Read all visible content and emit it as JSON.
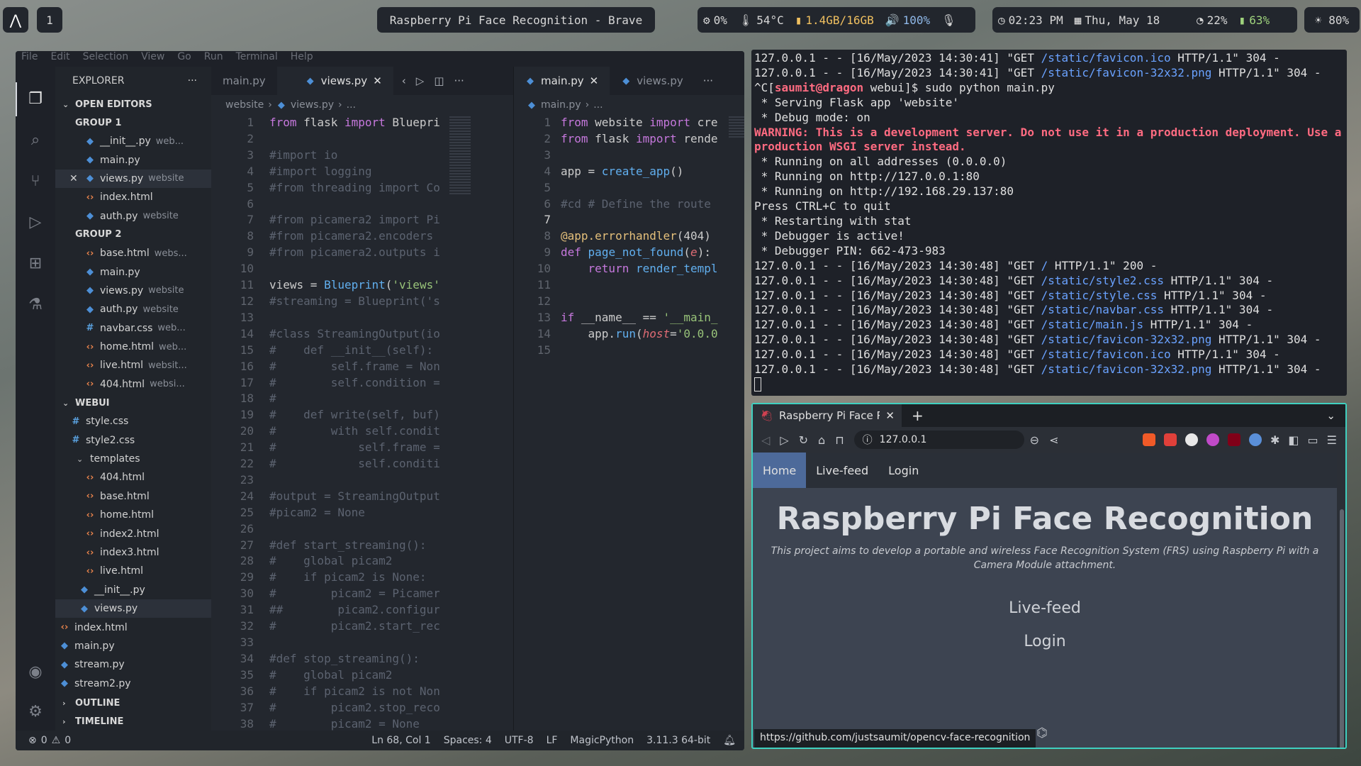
{
  "topbar": {
    "workspace": "1",
    "window_title": "Raspberry Pi Face Recognition - Brave",
    "cpu": "0%",
    "temp": "54°C",
    "memory": "1.4GB/16GB",
    "volume": "100%",
    "time": "02:23 PM",
    "date": "Thu, May 18",
    "wifi": "22%",
    "battery": "63%",
    "brightness": "80%"
  },
  "vscode": {
    "menu": [
      "File",
      "Edit",
      "Selection",
      "View",
      "Go",
      "Run",
      "Terminal",
      "Help"
    ],
    "explorer_title": "EXPLORER",
    "open_editors": "OPEN EDITORS",
    "group1": "GROUP 1",
    "group2": "GROUP 2",
    "group1_items": [
      {
        "name": "__init__.py",
        "desc": "web...",
        "type": "py"
      },
      {
        "name": "main.py",
        "desc": "",
        "type": "py"
      },
      {
        "name": "views.py",
        "desc": "website",
        "type": "py"
      },
      {
        "name": "index.html",
        "desc": "",
        "type": "html"
      },
      {
        "name": "auth.py",
        "desc": "website",
        "type": "py"
      }
    ],
    "group2_items": [
      {
        "name": "base.html",
        "desc": "webs...",
        "type": "html"
      },
      {
        "name": "main.py",
        "desc": "",
        "type": "py"
      },
      {
        "name": "views.py",
        "desc": "website",
        "type": "py"
      },
      {
        "name": "auth.py",
        "desc": "website",
        "type": "py"
      },
      {
        "name": "navbar.css",
        "desc": "web...",
        "type": "css"
      },
      {
        "name": "home.html",
        "desc": "web...",
        "type": "html"
      },
      {
        "name": "live.html",
        "desc": "websit...",
        "type": "html"
      },
      {
        "name": "404.html",
        "desc": "websi...",
        "type": "html"
      }
    ],
    "webui_section": "WEBUI",
    "webui_items": [
      "style.css",
      "style2.css"
    ],
    "templates_folder": "templates",
    "template_items": [
      "404.html",
      "base.html",
      "home.html",
      "index2.html",
      "index3.html",
      "live.html"
    ],
    "more_items": [
      {
        "name": "__init__.py",
        "type": "py"
      },
      {
        "name": "views.py",
        "type": "py"
      }
    ],
    "root_items": [
      {
        "name": "index.html",
        "type": "html"
      },
      {
        "name": "main.py",
        "type": "py"
      },
      {
        "name": "stream.py",
        "type": "py"
      },
      {
        "name": "stream2.py",
        "type": "py"
      }
    ],
    "outline": "OUTLINE",
    "timeline": "TIMELINE",
    "left_tabs": [
      "main.py",
      "views.py"
    ],
    "right_tabs": [
      "main.py",
      "views.py"
    ],
    "left_breadcrumb": [
      "website",
      "views.py",
      "..."
    ],
    "right_breadcrumb": [
      "main.py",
      "..."
    ],
    "status": {
      "problems": "0",
      "warnings": "0",
      "position": "Ln 68, Col 1",
      "spaces": "Spaces: 4",
      "encoding": "UTF-8",
      "eol": "LF",
      "language": "MagicPython",
      "interpreter": "3.11.3 64-bit"
    }
  },
  "terminal": {
    "lines": [
      "127.0.0.1 - - [16/May/2023 14:30:41] \"GET /static/favicon.ico HTTP/1.1\" 304 -",
      "127.0.0.1 - - [16/May/2023 14:30:41] \"GET /static/favicon-32x32.png HTTP/1.1\" 304 -",
      "^C[saumit@dragon webui]$ sudo python main.py",
      " * Serving Flask app 'website'",
      " * Debug mode: on",
      "WARNING: This is a development server. Do not use it in a production deployment. Use a production WSGI server instead.",
      " * Running on all addresses (0.0.0.0)",
      " * Running on http://127.0.0.1:80",
      " * Running on http://192.168.29.137:80",
      "Press CTRL+C to quit",
      " * Restarting with stat",
      " * Debugger is active!",
      " * Debugger PIN: 662-473-983",
      "127.0.0.1 - - [16/May/2023 14:30:48] \"GET / HTTP/1.1\" 200 -",
      "127.0.0.1 - - [16/May/2023 14:30:48] \"GET /static/style2.css HTTP/1.1\" 304 -",
      "127.0.0.1 - - [16/May/2023 14:30:48] \"GET /static/style.css HTTP/1.1\" 304 -",
      "127.0.0.1 - - [16/May/2023 14:30:48] \"GET /static/navbar.css HTTP/1.1\" 304 -",
      "127.0.0.1 - - [16/May/2023 14:30:48] \"GET /static/main.js HTTP/1.1\" 304 -",
      "127.0.0.1 - - [16/May/2023 14:30:48] \"GET /static/favicon-32x32.png HTTP/1.1\" 304 -",
      "127.0.0.1 - - [16/May/2023 14:30:48] \"GET /static/favicon.ico HTTP/1.1\" 304 -",
      "127.0.0.1 - - [16/May/2023 14:30:48] \"GET /static/favicon-32x32.png HTTP/1.1\" 304 -"
    ]
  },
  "browser": {
    "tab_title": "Raspberry Pi Face Recognit",
    "url": "127.0.0.1",
    "nav": [
      "Home",
      "Live-feed",
      "Login"
    ],
    "title": "Raspberry Pi Face Recognition",
    "subtitle": "This project aims to develop a portable and wireless Face Recognition System (FRS) using Raspberry Pi with a Camera Module attachment.",
    "links": [
      "Live-feed",
      "Login"
    ],
    "hover_url": "https://github.com/justsaumit/opencv-face-recognition"
  },
  "colors": {
    "accent_border": "#3fd0c0",
    "nav_active": "#4d6a9a",
    "warning": "#ff6b81"
  }
}
